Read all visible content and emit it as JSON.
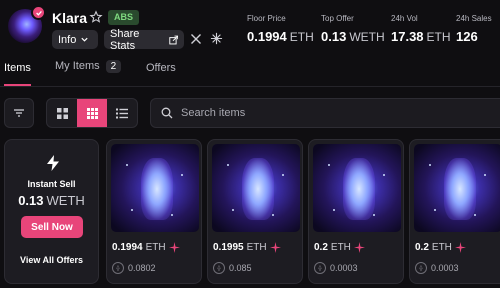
{
  "collection": {
    "name": "Klara",
    "chain_badge": "ABS",
    "info_label": "Info",
    "share_label": "Share Stats"
  },
  "stats": [
    {
      "label": "Floor Price",
      "value": "0.1994",
      "unit": "ETH"
    },
    {
      "label": "Top Offer",
      "value": "0.13",
      "unit": "WETH"
    },
    {
      "label": "24h Vol",
      "value": "17.38",
      "unit": "ETH"
    },
    {
      "label": "24h Sales",
      "value": "126",
      "unit": ""
    }
  ],
  "tabs": {
    "items": "Items",
    "my_items": "My Items",
    "my_items_count": "2",
    "offers": "Offers"
  },
  "search": {
    "placeholder": "Search items"
  },
  "instant_sell": {
    "title": "Instant Sell",
    "price": "0.13",
    "unit": "WETH",
    "button": "Sell Now",
    "view_all": "View All Offers"
  },
  "items": [
    {
      "price": "0.1994",
      "unit": "ETH",
      "offer": "0.0802"
    },
    {
      "price": "0.1995",
      "unit": "ETH",
      "offer": "0.085"
    },
    {
      "price": "0.2",
      "unit": "ETH",
      "offer": "0.0003"
    },
    {
      "price": "0.2",
      "unit": "ETH",
      "offer": "0.0003"
    }
  ],
  "colors": {
    "accent": "#e8457a",
    "background": "#0f0e11",
    "card": "#1d1c22"
  }
}
